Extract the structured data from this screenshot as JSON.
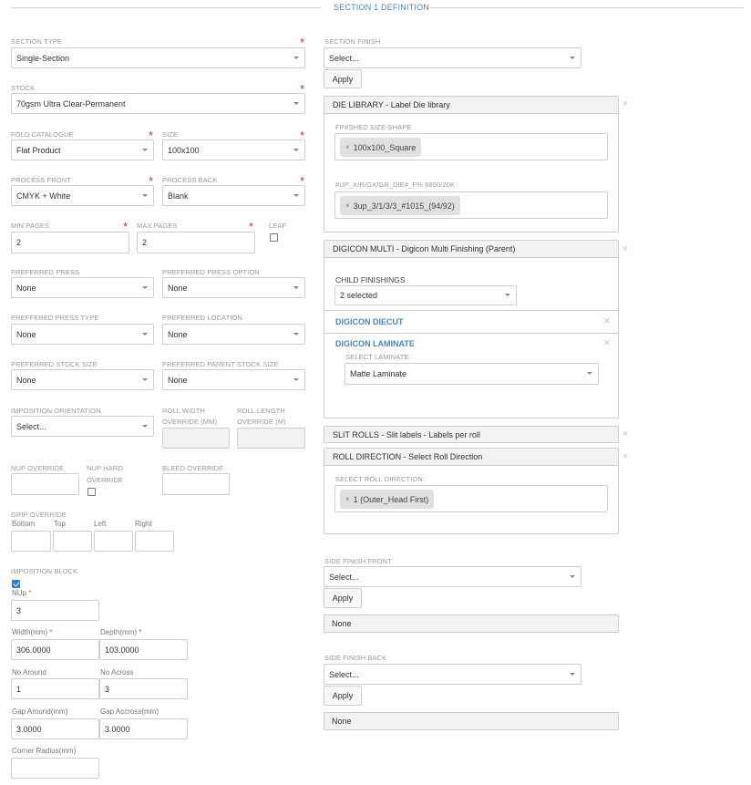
{
  "section_title": "SECTION 1 DEFINITION",
  "left": {
    "section_type": {
      "label": "SECTION TYPE",
      "value": "Single-Section"
    },
    "stock": {
      "label": "STOCK",
      "value": "70gsm Ultra Clear-Permanent"
    },
    "fold_catalogue": {
      "label": "FOLD CATALOGUE",
      "value": "Flat Product"
    },
    "size": {
      "label": "SIZE",
      "value": "100x100"
    },
    "process_front": {
      "label": "PROCESS FRONT",
      "value": "CMYK + White"
    },
    "process_back": {
      "label": "PROCESS BACK",
      "value": "Blank"
    },
    "min_pages": {
      "label": "MIN PAGES",
      "value": "2"
    },
    "max_pages": {
      "label": "MAX PAGES",
      "value": "2"
    },
    "leaf": {
      "label": "LEAF"
    },
    "preferred_press": {
      "label": "PREFERRED PRESS",
      "value": "None"
    },
    "preferred_press_option": {
      "label": "PREFERRED PRESS OPTION",
      "value": "None"
    },
    "preferred_press_type": {
      "label": "PREFFERED PRESS TYPE",
      "value": "None"
    },
    "preferred_location": {
      "label": "PREFERRED LOCATION",
      "value": "None"
    },
    "preferred_stock_size": {
      "label": "PREFERRED STOCK SIZE",
      "value": "None"
    },
    "preferred_parent_stock_size": {
      "label": "PREFERRED PARENT STOCK SIZE",
      "value": "None"
    },
    "imposition_orientation": {
      "label": "IMPOSITION ORIENTATION",
      "value": "Select..."
    },
    "roll_width_override": {
      "label1": "ROLL WIDTH",
      "label2": "OVERRIDE (MM)"
    },
    "roll_length_override": {
      "label1": "ROLL LENGTH",
      "label2": "OVERRIDE (M)"
    },
    "nup_override": {
      "label": "NUP OVERRIDE"
    },
    "nup_hard_override": {
      "label1": "NUP HARD",
      "label2": "OVERRIDE"
    },
    "bleed_override": {
      "label": "BLEED OVERRIDE"
    },
    "grip_override": {
      "label": "GRIP OVERRIDE",
      "bottom": "Bottom",
      "top": "Top",
      "left": "Left",
      "right": "Right"
    },
    "imposition_block": {
      "label": "IMPOSITION BLOCK"
    },
    "nup": {
      "label": "NUp *",
      "value": "3"
    },
    "width": {
      "label": "Width(mm) *",
      "value": "306.0000"
    },
    "depth": {
      "label": "Depth(mm) *",
      "value": "103.0000"
    },
    "no_around": {
      "label": "No Around",
      "value": "1"
    },
    "no_across": {
      "label": "No Across",
      "value": "3"
    },
    "gap_around": {
      "label": "Gap Around(mm)",
      "value": "3.0000"
    },
    "gap_across": {
      "label": "Gap Accross(mm)",
      "value": "3.0000"
    },
    "corner_radius": {
      "label": "Corner Radius(mm)",
      "value": ""
    }
  },
  "right": {
    "section_finish": {
      "label": "SECTION FINISH",
      "value": "Select...",
      "apply": "Apply"
    },
    "die_library": {
      "title": "DIE LIBRARY - Label Die library",
      "finished_size_label": "FINISHED SIZE-SHAPE",
      "finished_size_tag": "100x100_Square",
      "up_label": "#UP_X/R/GX/GR_DIE#_F% 6800/20K",
      "up_tag": "3up_3/1/3/3_#1015_(94/92)"
    },
    "digicon_multi": {
      "title": "DIGICON MULTI - Digicon Multi Finishing (Parent)",
      "child_label": "CHILD FINISHINGS",
      "child_value": "2 selected",
      "diecut": "DIGICON DIECUT",
      "laminate": "DIGICON LAMINATE",
      "select_laminate_label": "SELECT LAMINATE:",
      "laminate_value": "Matte Laminate"
    },
    "slit_rolls": {
      "title": "SLIT ROLLS - Slit labels - Labels per roll"
    },
    "roll_direction": {
      "title": "ROLL DIRECTION - Select Roll Direction",
      "select_label": "SELECT ROLL DIRECTION:",
      "tag": "1 (Outer_Head First)"
    },
    "side_finish_front": {
      "label": "SIDE FINISH FRONT",
      "value": "Select...",
      "apply": "Apply",
      "result": "None"
    },
    "side_finish_back": {
      "label": "SIDE FINISH BACK",
      "value": "Select...",
      "apply": "Apply",
      "result": "None"
    }
  },
  "icons": {
    "tag_remove": "×",
    "panel_close": "×",
    "required": "*"
  }
}
